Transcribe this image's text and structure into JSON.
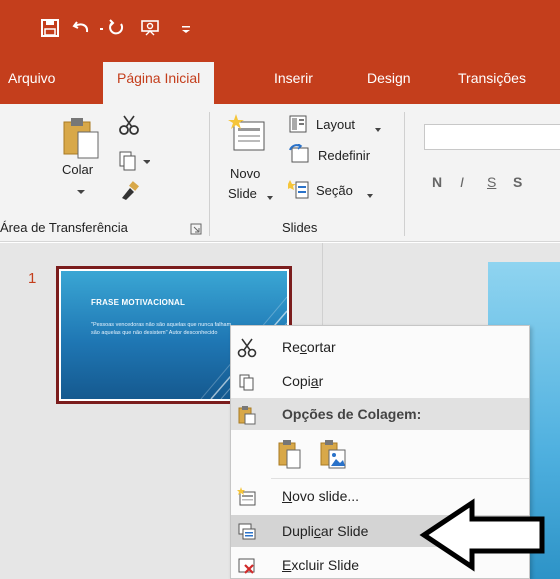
{
  "colors": {
    "accent": "#c43e1c",
    "ribbon": "#f3f3f3",
    "panel": "#e6e6e6",
    "thumb_border": "#7b1d1d"
  },
  "qat": {
    "icons": [
      "save-icon",
      "undo-icon",
      "redo-icon",
      "start-slideshow-icon",
      "customize-qat-icon"
    ]
  },
  "tabs": [
    "Arquivo",
    "Página Inicial",
    "Inserir",
    "Design",
    "Transições"
  ],
  "active_tab": "Página Inicial",
  "ribbon": {
    "clipboard": {
      "paste_label": "Colar",
      "group_label": "Área de Transferência"
    },
    "slides": {
      "new_slide_line1": "Novo",
      "new_slide_line2": "Slide",
      "layout_label": "Layout",
      "reset_label": "Redefinir",
      "section_label": "Seção",
      "group_label": "Slides"
    },
    "font": {
      "bold": "N",
      "italic": "I",
      "underline": "S",
      "strike": "S"
    }
  },
  "thumbnail": {
    "number": "1",
    "title": "FRASE MOTIVACIONAL",
    "body": "\"Pessoas vencedoras não são aquelas que nunca falham, são aquelas que não desistem\" Autor desconhecido"
  },
  "context_menu": {
    "cut_pre": "Re",
    "cut_u": "c",
    "cut_post": "ortar",
    "copy_pre": "Copi",
    "copy_u": "a",
    "copy_post": "r",
    "paste_options": "Opções de Colagem:",
    "new_slide_pre": "",
    "new_slide_u": "N",
    "new_slide_post": "ovo slide...",
    "duplicate_pre": "Dupli",
    "duplicate_u": "c",
    "duplicate_post": "ar Slide",
    "delete_pre": "",
    "delete_u": "E",
    "delete_post": "xcluir Slide"
  }
}
